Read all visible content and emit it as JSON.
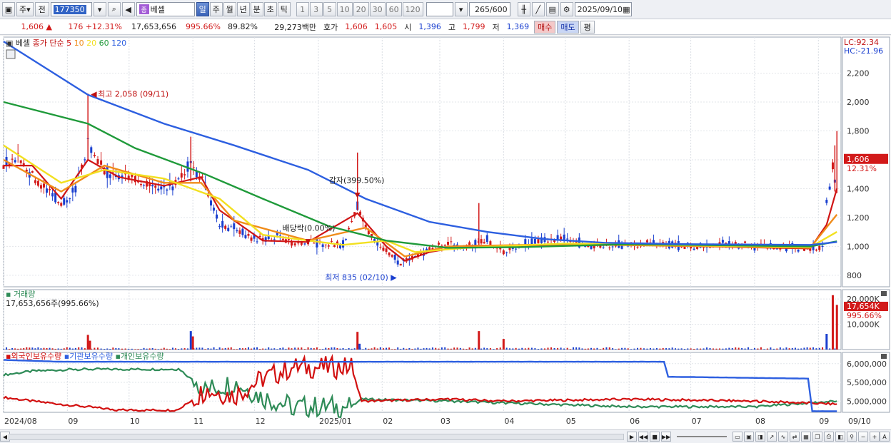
{
  "toolbar": {
    "market": "주",
    "prev_label": "전",
    "code": "177350",
    "name": "베셀",
    "periods": [
      "일",
      "주",
      "월",
      "년",
      "분",
      "초",
      "틱"
    ],
    "active_period": "일",
    "intervals": [
      "1",
      "3",
      "5",
      "10",
      "20",
      "30",
      "60",
      "120"
    ],
    "count": "265",
    "count_total": "/600",
    "date": "2025/09/10"
  },
  "quote": {
    "price": "1,606",
    "change": "176",
    "change_pct": "+12.31%",
    "volume": "17,653,656",
    "vol_ratio": "995.66%",
    "turnover": "89.82%",
    "amount": "29,273백만",
    "ask_label": "호가",
    "ask": "1,606",
    "bid": "1,605",
    "open_label": "시",
    "open": "1,396",
    "high_label": "고",
    "high": "1,799",
    "low_label": "저",
    "low": "1,369",
    "buy_label": "매수",
    "sell_label": "매도",
    "eval_label": "평"
  },
  "colors": {
    "up": "#d21a1a",
    "down": "#1a3fcf",
    "ma5": "#d01515",
    "ma10": "#f08c1a",
    "ma20": "#f2e020",
    "ma60": "#1f9a3a",
    "ma120": "#2d5fe0",
    "foreign": "#d21010",
    "inst": "#2d5fe0",
    "retail": "#2e8b57"
  },
  "chart_data": [
    {
      "type": "line",
      "legend": {
        "name": "베셀",
        "ma_label": "종가 단순",
        "ma_periods": [
          "5",
          "10",
          "20",
          "60",
          "120"
        ]
      },
      "lc": "LC:92.34",
      "hc": "HC:-21.96",
      "y_ticks": [
        "2,200",
        "2,000",
        "1,800",
        "1,600",
        "1,400",
        "1,200",
        "1,000",
        "800"
      ],
      "ylim": [
        720,
        2450
      ],
      "last_price": "1,606",
      "last_pct": "12.31%",
      "annotations": [
        {
          "text": "최고 2,058 (09/11)",
          "date": "2024/09/11",
          "value": 2058
        },
        {
          "text": "감자(399.50%)",
          "date": "2025/01/20",
          "value": 1320
        },
        {
          "text": "배당락(0.00%)",
          "date": "2024/12/27",
          "value": 1010
        },
        {
          "text": "최저 835 (02/10)",
          "date": "2025/02/10",
          "value": 835
        }
      ],
      "price_series": [
        [
          "2024/08/01",
          1560
        ],
        [
          "2024/08/08",
          1620
        ],
        [
          "2024/08/15",
          1480
        ],
        [
          "2024/08/22",
          1380
        ],
        [
          "2024/08/29",
          1300
        ],
        [
          "2024/09/05",
          1380
        ],
        [
          "2024/09/11",
          1700
        ],
        [
          "2024/09/19",
          1520
        ],
        [
          "2024/09/26",
          1490
        ],
        [
          "2024/10/04",
          1460
        ],
        [
          "2024/10/11",
          1420
        ],
        [
          "2024/10/18",
          1400
        ],
        [
          "2024/10/25",
          1430
        ],
        [
          "2024/10/31",
          1580
        ],
        [
          "2024/11/07",
          1420
        ],
        [
          "2024/11/14",
          1150
        ],
        [
          "2024/11/21",
          1120
        ],
        [
          "2024/11/28",
          1060
        ],
        [
          "2024/12/05",
          1030
        ],
        [
          "2024/12/12",
          1060
        ],
        [
          "2024/12/19",
          1020
        ],
        [
          "2024/12/27",
          1030
        ],
        [
          "2025/01/06",
          1010
        ],
        [
          "2025/01/13",
          1010
        ],
        [
          "2025/01/20",
          1280
        ],
        [
          "2025/01/24",
          1120
        ],
        [
          "2025/02/03",
          960
        ],
        [
          "2025/02/10",
          880
        ],
        [
          "2025/02/17",
          930
        ],
        [
          "2025/02/24",
          980
        ],
        [
          "2025/03/05",
          1010
        ],
        [
          "2025/03/14",
          1000
        ],
        [
          "2025/03/24",
          1040
        ],
        [
          "2025/04/01",
          960
        ],
        [
          "2025/04/10",
          1010
        ],
        [
          "2025/04/21",
          1040
        ],
        [
          "2025/05/02",
          1050
        ],
        [
          "2025/05/15",
          1000
        ],
        [
          "2025/06/02",
          1010
        ],
        [
          "2025/06/16",
          1020
        ],
        [
          "2025/07/01",
          990
        ],
        [
          "2025/07/15",
          1010
        ],
        [
          "2025/08/01",
          1000
        ],
        [
          "2025/08/15",
          990
        ],
        [
          "2025/08/28",
          980
        ],
        [
          "2025/09/03",
          990
        ],
        [
          "2025/09/05",
          1300
        ],
        [
          "2025/09/08",
          1550
        ],
        [
          "2025/09/09",
          1430
        ],
        [
          "2025/09/10",
          1606
        ]
      ],
      "ma_series": {
        "5": [
          [
            "2024/08/01",
            1560
          ],
          [
            "2024/08/15",
            1560
          ],
          [
            "2024/08/29",
            1330
          ],
          [
            "2024/09/11",
            1600
          ],
          [
            "2024/09/26",
            1480
          ],
          [
            "2024/10/18",
            1420
          ],
          [
            "2024/11/05",
            1480
          ],
          [
            "2024/11/14",
            1250
          ],
          [
            "2024/12/05",
            1040
          ],
          [
            "2024/12/27",
            1030
          ],
          [
            "2025/01/20",
            1230
          ],
          [
            "2025/02/03",
            1000
          ],
          [
            "2025/02/12",
            900
          ],
          [
            "2025/02/24",
            960
          ],
          [
            "2025/03/14",
            1005
          ],
          [
            "2025/04/10",
            1005
          ],
          [
            "2025/06/01",
            1010
          ],
          [
            "2025/08/28",
            985
          ],
          [
            "2025/09/05",
            1150
          ],
          [
            "2025/09/10",
            1400
          ]
        ],
        "10": [
          [
            "2024/08/01",
            1600
          ],
          [
            "2024/08/29",
            1380
          ],
          [
            "2024/09/19",
            1560
          ],
          [
            "2024/10/18",
            1440
          ],
          [
            "2024/11/05",
            1440
          ],
          [
            "2024/11/21",
            1180
          ],
          [
            "2024/12/27",
            1040
          ],
          [
            "2025/01/24",
            1130
          ],
          [
            "2025/02/12",
            930
          ],
          [
            "2025/03/05",
            1000
          ],
          [
            "2025/05/01",
            1015
          ],
          [
            "2025/08/28",
            990
          ],
          [
            "2025/09/10",
            1220
          ]
        ],
        "20": [
          [
            "2024/08/01",
            1700
          ],
          [
            "2024/08/29",
            1440
          ],
          [
            "2024/09/19",
            1530
          ],
          [
            "2024/10/18",
            1470
          ],
          [
            "2024/11/14",
            1330
          ],
          [
            "2024/12/05",
            1080
          ],
          [
            "2025/01/13",
            1010
          ],
          [
            "2025/02/03",
            1040
          ],
          [
            "2025/02/17",
            960
          ],
          [
            "2025/03/14",
            990
          ],
          [
            "2025/05/01",
            1020
          ],
          [
            "2025/08/28",
            995
          ],
          [
            "2025/09/10",
            1100
          ]
        ],
        "60": [
          [
            "2024/08/01",
            2000
          ],
          [
            "2024/09/11",
            1850
          ],
          [
            "2024/10/04",
            1680
          ],
          [
            "2024/11/07",
            1500
          ],
          [
            "2024/12/05",
            1330
          ],
          [
            "2025/01/06",
            1140
          ],
          [
            "2025/02/03",
            1040
          ],
          [
            "2025/03/05",
            990
          ],
          [
            "2025/04/10",
            995
          ],
          [
            "2025/06/01",
            1015
          ],
          [
            "2025/08/28",
            1000
          ],
          [
            "2025/09/10",
            1035
          ]
        ],
        "120": [
          [
            "2024/08/01",
            2420
          ],
          [
            "2024/09/11",
            2050
          ],
          [
            "2024/10/18",
            1850
          ],
          [
            "2024/11/21",
            1700
          ],
          [
            "2024/12/27",
            1530
          ],
          [
            "2025/01/24",
            1330
          ],
          [
            "2025/02/24",
            1170
          ],
          [
            "2025/03/24",
            1100
          ],
          [
            "2025/04/21",
            1050
          ],
          [
            "2025/05/20",
            1025
          ],
          [
            "2025/07/01",
            1015
          ],
          [
            "2025/08/28",
            1010
          ],
          [
            "2025/09/10",
            1030
          ]
        ]
      }
    },
    {
      "type": "bar",
      "title": "거래량",
      "value_label": "17,653,656주(995.66%)",
      "y_ticks": [
        "20,000K",
        "10,000K"
      ],
      "ylim": [
        0,
        22000
      ],
      "last_label": "17,654K",
      "last_pct": "995.66%",
      "spikes": [
        [
          "2024/09/11",
          5800
        ],
        [
          "2024/09/12",
          3500
        ],
        [
          "2024/10/31",
          7300
        ],
        [
          "2024/11/01",
          5200
        ],
        [
          "2025/01/20",
          7000
        ],
        [
          "2025/01/21",
          2300
        ],
        [
          "2025/03/20",
          7300
        ],
        [
          "2025/04/01",
          4200
        ],
        [
          "2025/09/05",
          6200
        ],
        [
          "2025/09/08",
          21500
        ],
        [
          "2025/09/10",
          17654
        ]
      ]
    },
    {
      "type": "line",
      "series": [
        {
          "name": "외국인보유수량"
        },
        {
          "name": "기관보유수량"
        },
        {
          "name": "개인보유수량"
        }
      ],
      "y_ticks": [
        "6,000,000",
        "5,500,000",
        "5,000,000"
      ],
      "ylim": [
        4700000,
        6300000
      ],
      "inst_series": [
        [
          "2024/08/01",
          6100000
        ],
        [
          "2024/08/29",
          6050000
        ],
        [
          "2024/10/04",
          6050000
        ],
        [
          "2024/11/01",
          6050000
        ],
        [
          "2024/12/27",
          6050000
        ],
        [
          "2025/06/18",
          6050000
        ],
        [
          "2025/06/20",
          5650000
        ],
        [
          "2025/08/27",
          5600000
        ],
        [
          "2025/08/29",
          4730000
        ],
        [
          "2025/09/10",
          4730000
        ]
      ],
      "foreign_series": [
        [
          "2024/08/01",
          5100000
        ],
        [
          "2024/08/15",
          5000000
        ],
        [
          "2024/09/01",
          4900000
        ],
        [
          "2024/09/26",
          4760000
        ],
        [
          "2024/10/25",
          4760000
        ],
        [
          "2024/11/07",
          5300000
        ],
        [
          "2024/11/21",
          5150000
        ],
        [
          "2024/12/05",
          5600000
        ],
        [
          "2024/12/20",
          5900000
        ],
        [
          "2025/01/17",
          5900000
        ],
        [
          "2025/01/22",
          5000000
        ],
        [
          "2025/03/05",
          5050000
        ],
        [
          "2025/04/01",
          5000000
        ],
        [
          "2025/06/01",
          5050000
        ],
        [
          "2025/08/01",
          5000000
        ],
        [
          "2025/09/10",
          4920000
        ]
      ],
      "retail_series": [
        [
          "2024/08/01",
          5700000
        ],
        [
          "2024/08/15",
          5800000
        ],
        [
          "2024/09/05",
          5850000
        ],
        [
          "2024/10/25",
          5850000
        ],
        [
          "2024/11/07",
          5300000
        ],
        [
          "2024/11/21",
          5500000
        ],
        [
          "2024/12/05",
          5100000
        ],
        [
          "2024/12/20",
          4850000
        ],
        [
          "2025/01/17",
          4850000
        ],
        [
          "2025/01/22",
          5050000
        ],
        [
          "2025/03/05",
          5000000
        ],
        [
          "2025/04/01",
          4950000
        ],
        [
          "2025/06/01",
          4850000
        ],
        [
          "2025/08/01",
          4850000
        ],
        [
          "2025/09/10",
          5000000
        ]
      ]
    }
  ],
  "x_axis": {
    "labels": [
      [
        "2024/08/01",
        "2024/08"
      ],
      [
        "2024/09/01",
        "09"
      ],
      [
        "2024/10/01",
        "10"
      ],
      [
        "2024/11/01",
        "11"
      ],
      [
        "2024/12/01",
        "12"
      ],
      [
        "2025/01/01",
        "2025/01"
      ],
      [
        "2025/02/01",
        "02"
      ],
      [
        "2025/03/01",
        "03"
      ],
      [
        "2025/04/01",
        "04"
      ],
      [
        "2025/05/01",
        "05"
      ],
      [
        "2025/06/01",
        "06"
      ],
      [
        "2025/07/01",
        "07"
      ],
      [
        "2025/08/01",
        "08"
      ],
      [
        "2025/09/01",
        "09"
      ]
    ],
    "last_date_label": "09/10",
    "start": "2024/08/01",
    "end": "2025/09/12"
  }
}
